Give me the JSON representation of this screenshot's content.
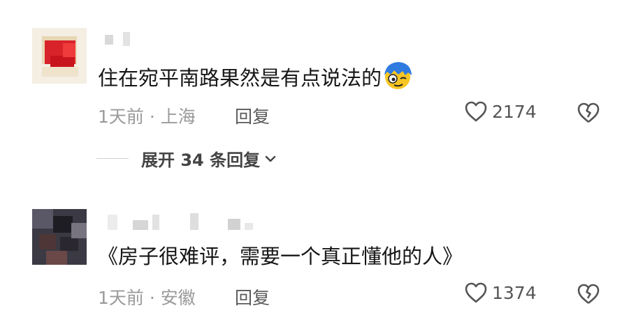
{
  "comments": [
    {
      "content": "住在宛平南路果然是有点说法的",
      "emoji": "dizzy-face-emoji",
      "time": "1天前",
      "location": "上海",
      "reply_label": "回复",
      "likes": "2174",
      "expand_label": "展开 34 条回复"
    },
    {
      "content": "《房子很难评，需要一个真正懂他的人》",
      "time": "1天前",
      "location": "安徽",
      "reply_label": "回复",
      "likes": "1374"
    }
  ],
  "meta_separator": " · ",
  "colors": {
    "text": "#161616",
    "meta": "#9a9a9a",
    "emoji_blue": "#2f7be0",
    "emoji_yellow": "#f7c623"
  }
}
